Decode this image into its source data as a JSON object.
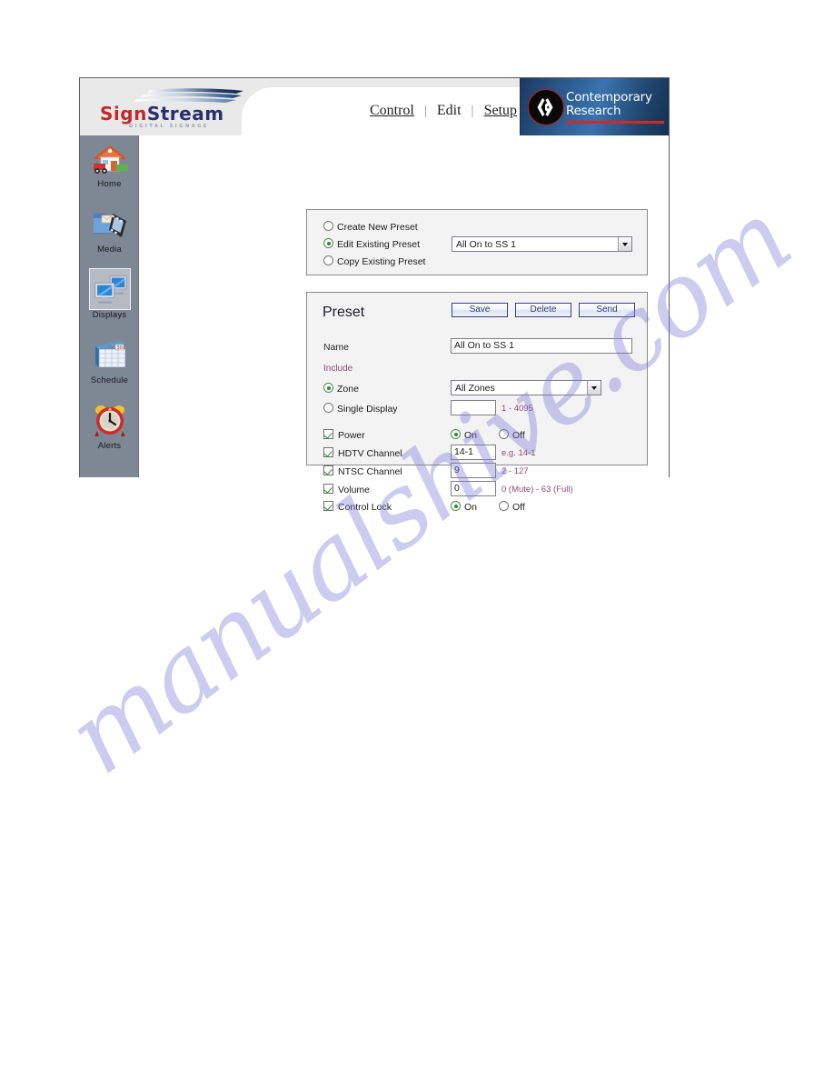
{
  "watermark": {
    "text": "manualshive.com"
  },
  "header": {
    "logo": {
      "brand_sign": "Sign",
      "brand_stream": "Stream",
      "tagline": "DIGITAL SIGNAGE"
    },
    "nav": {
      "items": [
        {
          "label": "Control",
          "current": false
        },
        {
          "label": "Edit",
          "current": true
        },
        {
          "label": "Setup",
          "current": false
        }
      ],
      "separator": "|"
    },
    "partner_logo": {
      "line1": "Contemporary",
      "line2": "Research",
      "accent_color": "#cf2b24",
      "background_color": "#2e5e93"
    }
  },
  "sidebar": {
    "items": [
      {
        "label": "Home",
        "icon": "house-icon",
        "selected": false
      },
      {
        "label": "Media",
        "icon": "media-folder-icon",
        "selected": false
      },
      {
        "label": "Displays",
        "icon": "monitors-icon",
        "selected": true
      },
      {
        "label": "Schedule",
        "icon": "calendar-icon",
        "selected": false
      },
      {
        "label": "Alerts",
        "icon": "alarm-clock-icon",
        "selected": false
      }
    ],
    "background_color": "#7e8794"
  },
  "mode_panel": {
    "options": [
      {
        "label": "Create New Preset",
        "selected": false
      },
      {
        "label": "Edit Existing Preset",
        "selected": true
      },
      {
        "label": "Copy Existing Preset",
        "selected": false
      }
    ],
    "preset_select": {
      "value": "All On to SS 1",
      "icon": "chevron-down-icon"
    }
  },
  "preset_panel": {
    "title": "Preset",
    "buttons": [
      {
        "label": "Save"
      },
      {
        "label": "Delete"
      },
      {
        "label": "Send"
      }
    ],
    "name_label": "Name",
    "name_value": "All On to SS 1",
    "include_label": "Include",
    "target": {
      "zone": {
        "label": "Zone",
        "selected": true,
        "select_value": "All Zones"
      },
      "single_display": {
        "label": "Single Display",
        "selected": false,
        "value": "",
        "hint": "1 - 4095"
      }
    },
    "settings": [
      {
        "label": "Power",
        "checked": true,
        "control": "radio",
        "radio_on_label": "On",
        "radio_off_label": "Off",
        "radio_selected": "On"
      },
      {
        "label": "HDTV Channel",
        "checked": true,
        "control": "text",
        "value": "14-1",
        "hint": "e.g. 14-1"
      },
      {
        "label": "NTSC Channel",
        "checked": true,
        "control": "text",
        "value": "9",
        "hint": "2 - 127"
      },
      {
        "label": "Volume",
        "checked": true,
        "control": "text",
        "value": "0",
        "hint": "0 (Mute) - 63 (Full)"
      },
      {
        "label": "Control Lock",
        "checked": true,
        "control": "radio",
        "radio_on_label": "On",
        "radio_off_label": "Off",
        "radio_selected": "On"
      }
    ]
  }
}
